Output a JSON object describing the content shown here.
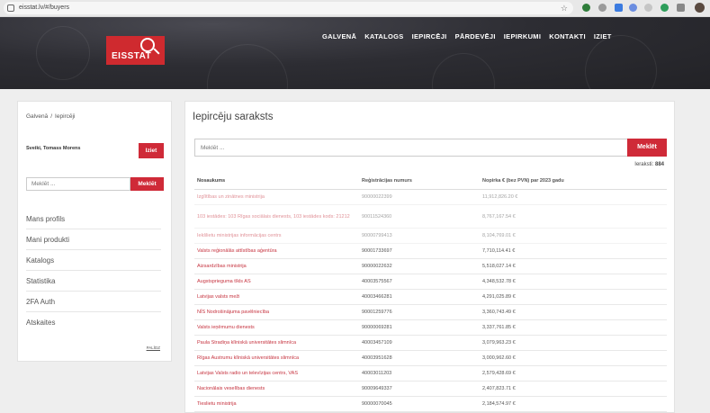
{
  "browser": {
    "url": "eisstat.lv/#/buyers"
  },
  "header": {
    "logo_text": "EISSTAT",
    "nav": [
      "GALVENĀ",
      "KATALOGS",
      "IEPIRCĒJI",
      "PĀRDEVĒJI",
      "IEPIRKUMI",
      "KONTAKTI",
      "IZIET"
    ]
  },
  "sidebar": {
    "breadcrumb": [
      "Galvenā",
      "Iepircēji"
    ],
    "username": "Sveiki, Tomass Morens",
    "logout_label": "Iziet",
    "search_placeholder": "Meklēt ...",
    "search_button": "Meklēt",
    "menu": [
      "Mans profils",
      "Mani produkti",
      "Katalogs",
      "Statistika",
      "2FA Auth",
      "Atskaites"
    ],
    "footer_link": "PALĪDZ"
  },
  "main": {
    "title": "Iepircēju saraksts",
    "search_placeholder": "Meklēt ...",
    "search_button": "Meklēt",
    "count_label": "Ieraksti:",
    "count_value": "884",
    "columns": [
      "Nosaukums",
      "Reģistrācijas numurs",
      "Nopirka € (bez PVN) par 2023 gadu"
    ],
    "rows": [
      {
        "name": "Izglītības un zinātnes ministrija",
        "reg": "90000022399",
        "amount": "11,912,826.20 €"
      },
      {
        "name": "103 iestādes: 103 Rīgas sociālais dienests, 103 iestādes kods: 21212",
        "reg": "90011524360",
        "amount": "8,767,167.54 €"
      },
      {
        "name": "Iekšlietu ministrijas informācijas centrs",
        "reg": "90000799413",
        "amount": "8,104,769.01 €"
      },
      {
        "name": "Valsts reģionālās attīstības aģentūra",
        "reg": "90001733697",
        "amount": "7,710,114.41 €"
      },
      {
        "name": "Aizsardzības ministrija",
        "reg": "90000022632",
        "amount": "5,518,027.14 €"
      },
      {
        "name": "Augstsprieguma tīkls AS",
        "reg": "40003575567",
        "amount": "4,348,532.78 €"
      },
      {
        "name": "Latvijas valsts meži",
        "reg": "40003466281",
        "amount": "4,291,025.89 €"
      },
      {
        "name": "NĪS Nodrošinājuma pavēlniecība",
        "reg": "90001259776",
        "amount": "3,360,743.49 €"
      },
      {
        "name": "Valsts ieņēmumu dienests",
        "reg": "90000069281",
        "amount": "3,337,761.85 €"
      },
      {
        "name": "Paula Stradiņa klīniskā universitātes slimnīca",
        "reg": "40003457109",
        "amount": "3,079,963.23 €"
      },
      {
        "name": "Rīgas Austrumu klīniskā universitātes slimnīca",
        "reg": "40003951628",
        "amount": "3,000,962.60 €"
      },
      {
        "name": "Latvijas Valsts radio un televīzijas centrs, VAS",
        "reg": "40003011203",
        "amount": "2,579,428.69 €"
      },
      {
        "name": "Nacionālais veselības dienests",
        "reg": "90009649337",
        "amount": "2,407,823.71 €"
      },
      {
        "name": "Tieslietu ministrija",
        "reg": "90000070045",
        "amount": "2,184,574.97 €"
      }
    ]
  }
}
